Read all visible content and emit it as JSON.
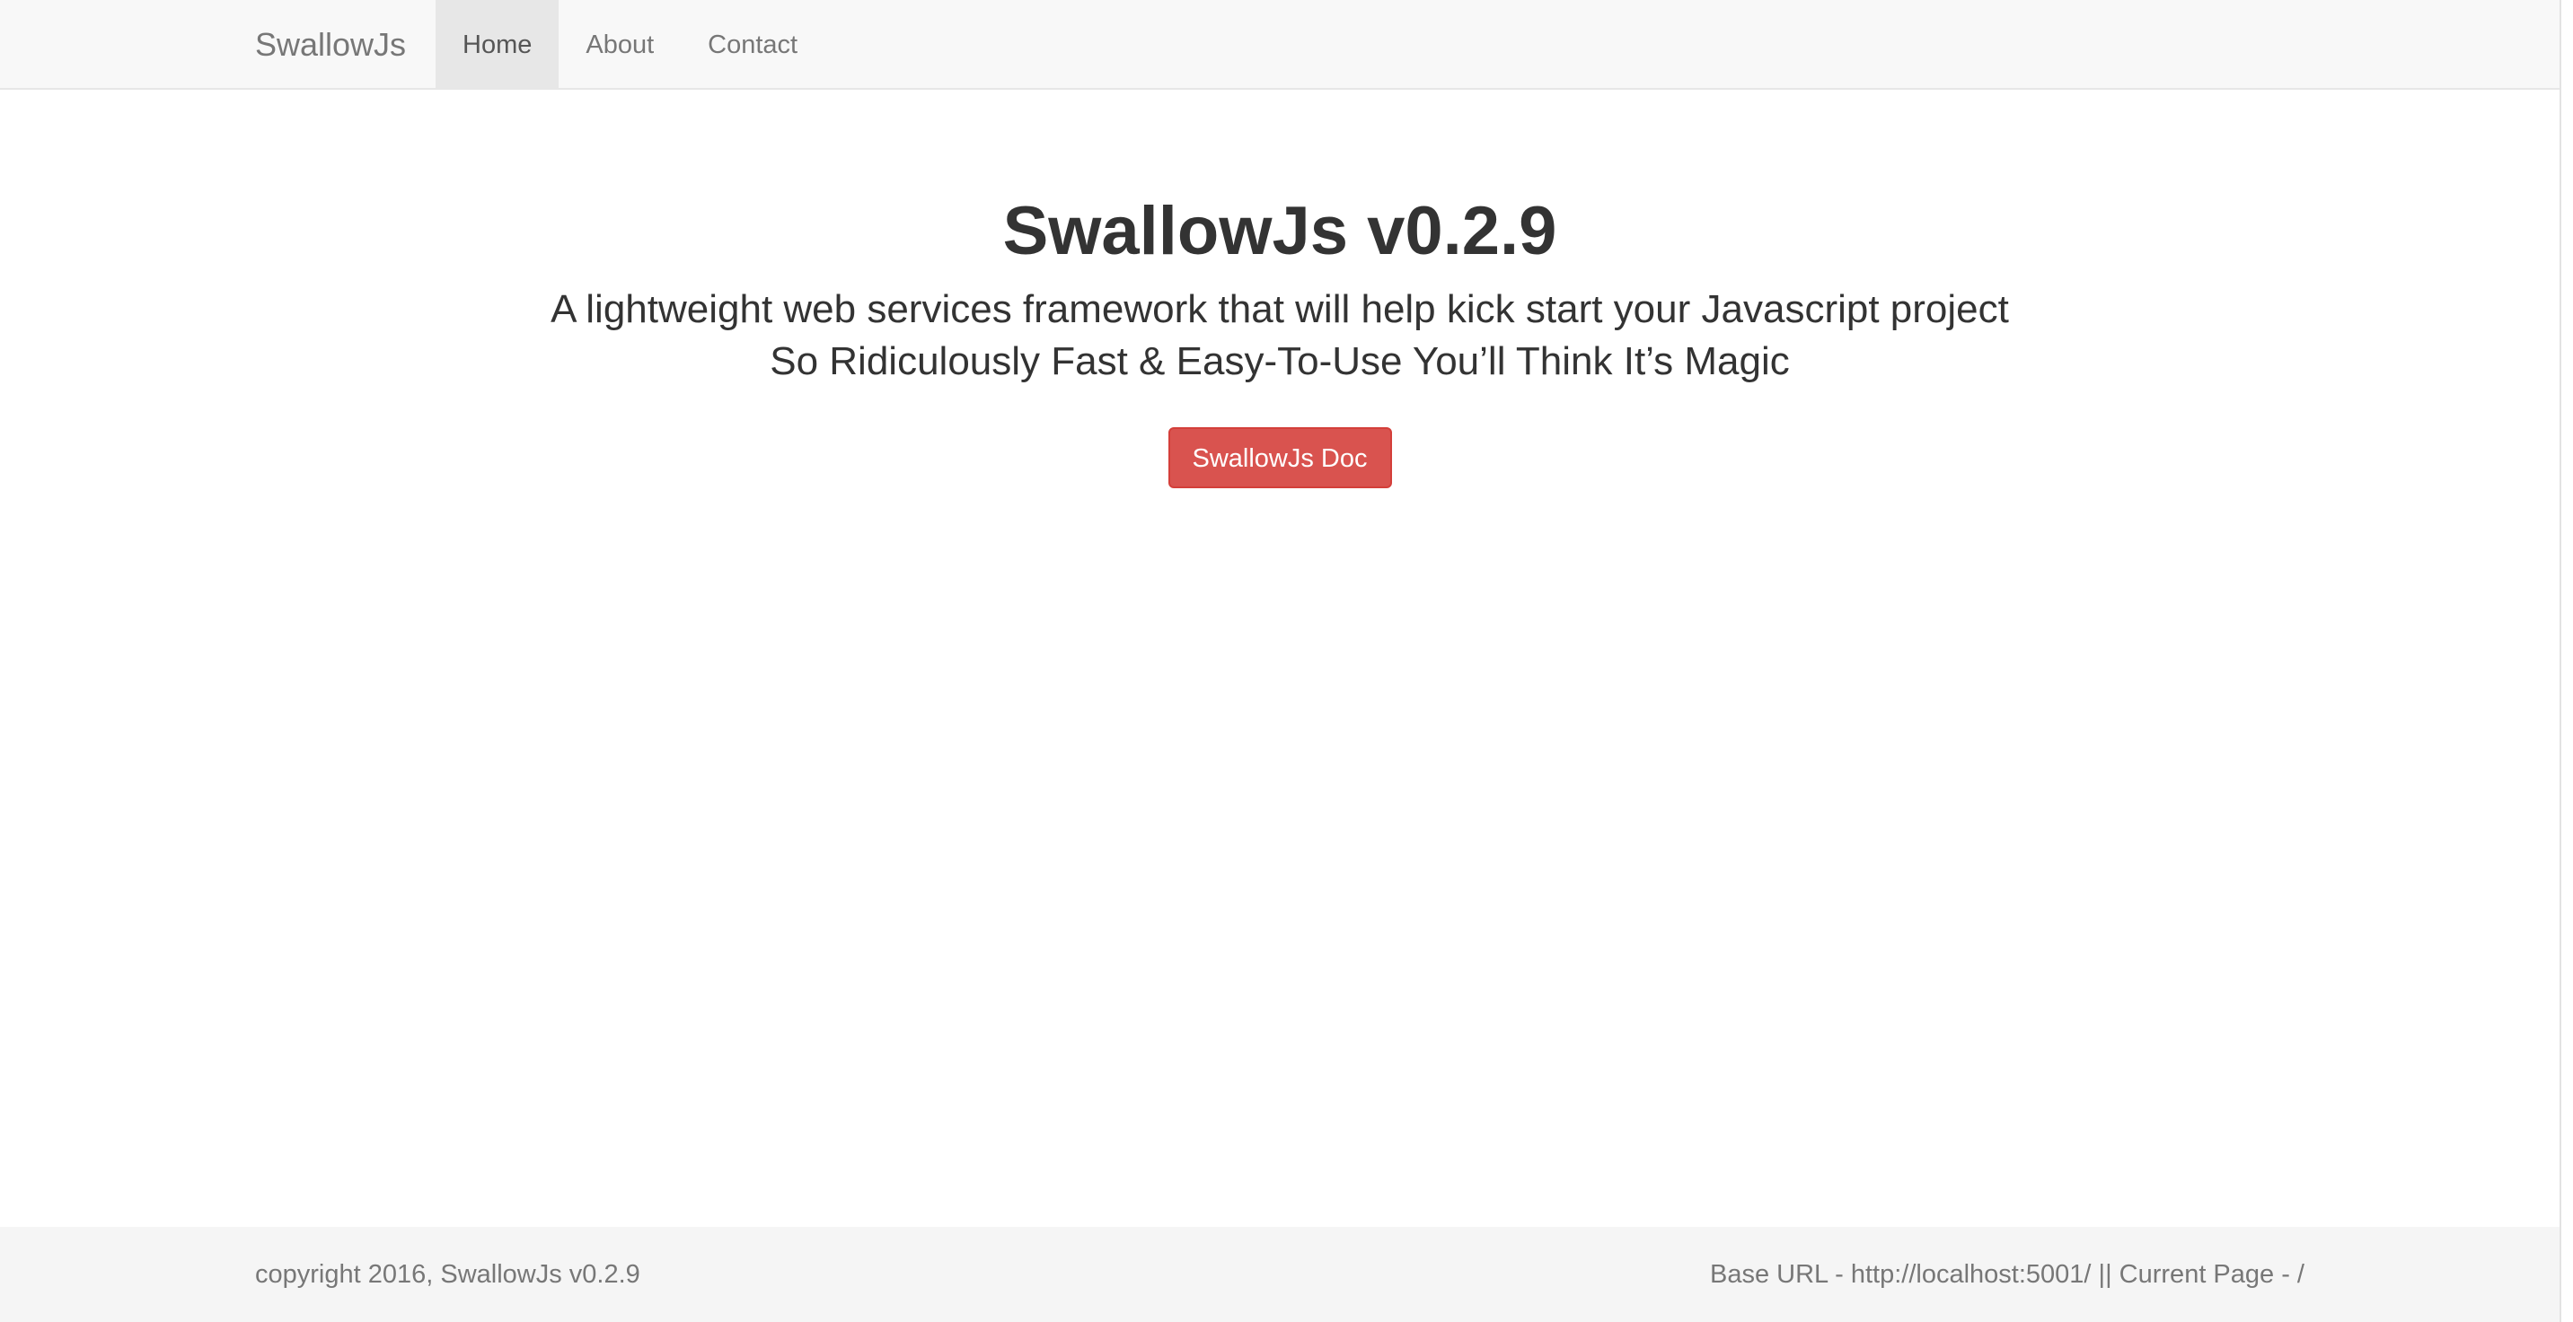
{
  "navbar": {
    "brand": "SwallowJs",
    "items": [
      {
        "label": "Home",
        "active": true
      },
      {
        "label": "About",
        "active": false
      },
      {
        "label": "Contact",
        "active": false
      }
    ]
  },
  "hero": {
    "title": "SwallowJs v0.2.9",
    "subtitle_line1": "A lightweight web services framework that will help kick start your Javascript project",
    "subtitle_line2": "So Ridiculously Fast & Easy-To-Use You’ll Think It’s Magic",
    "button_label": "SwallowJs Doc"
  },
  "footer": {
    "copyright": "copyright 2016, SwallowJs v0.2.9",
    "info": "Base URL - http://localhost:5001/ || Current Page - /"
  },
  "colors": {
    "navbar_bg": "#f8f8f8",
    "active_nav_bg": "#e7e7e7",
    "button_bg": "#d9534f",
    "footer_bg": "#f5f5f5",
    "text_dark": "#333333",
    "text_muted": "#777777"
  }
}
